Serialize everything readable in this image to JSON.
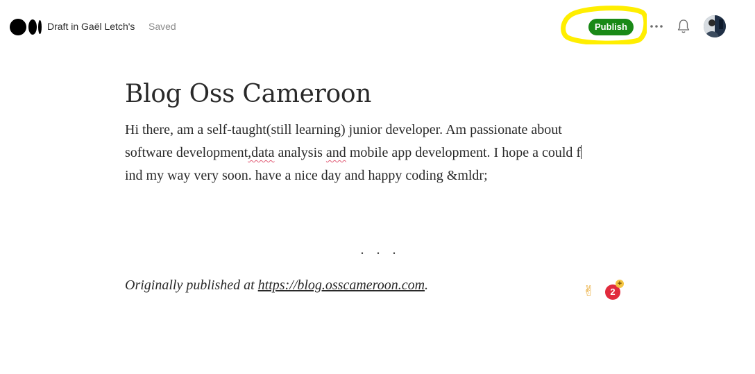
{
  "topbar": {
    "draft_label": "Draft in Gaël Letch's",
    "status": "Saved",
    "publish_label": "Publish",
    "highlight_color": "#ffee00",
    "publish_color": "#1a8917",
    "icons": [
      "medium-logo-icon",
      "more-icon",
      "bell-icon",
      "avatar"
    ]
  },
  "article": {
    "title": "Blog Oss Cameroon",
    "body": {
      "seg1": "Hi there, am a self-taught(still learning) junior developer. Am passionate about software development",
      "seg2": ",data",
      "seg3": " analysis ",
      "seg4": "and",
      "seg5": " mobile app development. I hope a could f",
      "seg6": "ind my way very soon. have a nice day and happy coding &mldr;"
    },
    "separator": "...",
    "originally_prefix": "Originally published at ",
    "originally_link": "https://blog.osscameroon.com",
    "originally_suffix": "."
  },
  "grammar_widget": {
    "emoji": "✌",
    "count": "2",
    "plus": "+",
    "badge_color": "#e12b3d"
  }
}
